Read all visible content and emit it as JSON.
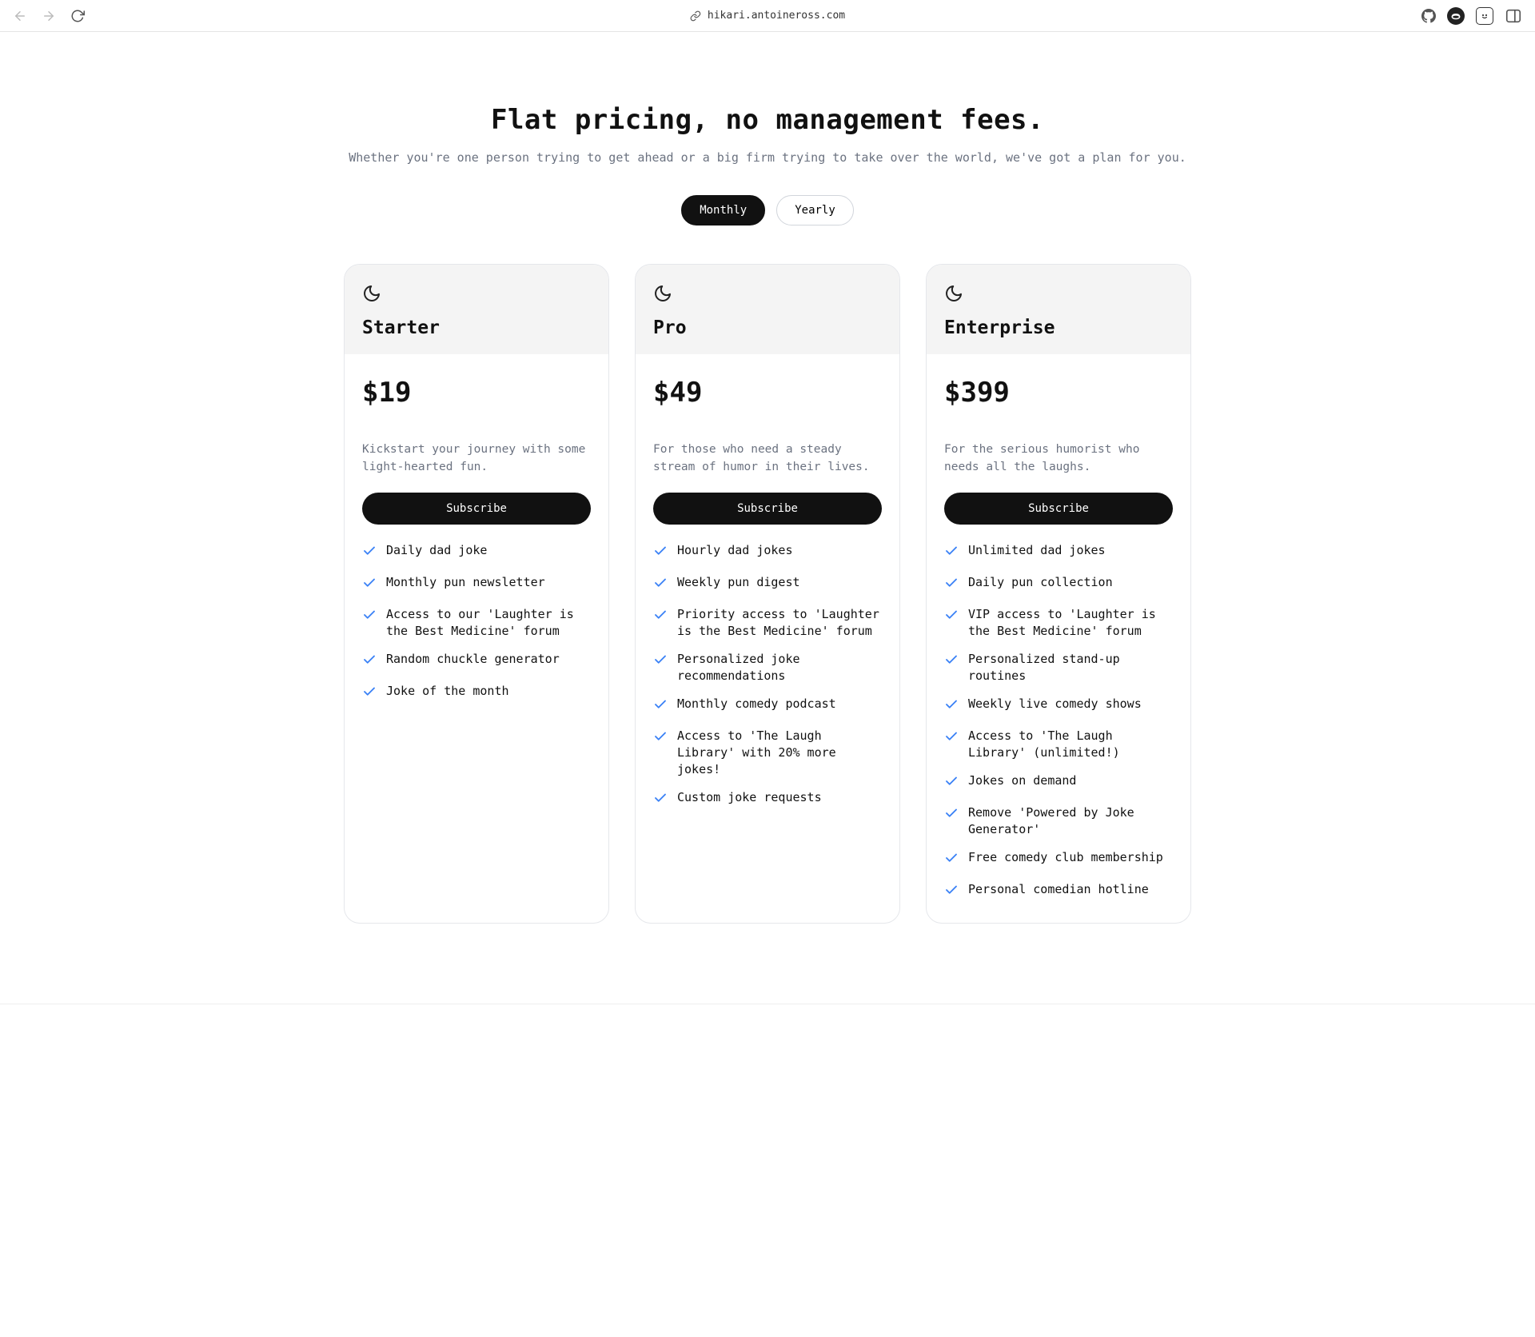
{
  "browser": {
    "url": "hikari.antoineross.com"
  },
  "hero": {
    "title": "Flat pricing, no management fees.",
    "subtitle": "Whether you're one person trying to get ahead or a big firm trying to take over the world, we've got a plan for you."
  },
  "toggle": {
    "monthly": "Monthly",
    "yearly": "Yearly"
  },
  "plans": [
    {
      "name": "Starter",
      "price": "$19",
      "description": "Kickstart your journey with some light-hearted fun.",
      "cta": "Subscribe",
      "features": [
        "Daily dad joke",
        "Monthly pun newsletter",
        "Access to our 'Laughter is the Best Medicine' forum",
        "Random chuckle generator",
        "Joke of the month"
      ]
    },
    {
      "name": "Pro",
      "price": "$49",
      "description": "For those who need a steady stream of humor in their lives.",
      "cta": "Subscribe",
      "features": [
        "Hourly dad jokes",
        "Weekly pun digest",
        "Priority access to 'Laughter is the Best Medicine' forum",
        "Personalized joke recommendations",
        "Monthly comedy podcast",
        "Access to 'The Laugh Library' with 20% more jokes!",
        "Custom joke requests"
      ]
    },
    {
      "name": "Enterprise",
      "price": "$399",
      "description": "For the serious humorist who needs all the laughs.",
      "cta": "Subscribe",
      "features": [
        "Unlimited dad jokes",
        "Daily pun collection",
        "VIP access to 'Laughter is the Best Medicine' forum",
        "Personalized stand-up routines",
        "Weekly live comedy shows",
        "Access to 'The Laugh Library' (unlimited!)",
        "Jokes on demand",
        "Remove 'Powered by Joke Generator'",
        "Free comedy club membership",
        "Personal comedian hotline"
      ]
    }
  ]
}
